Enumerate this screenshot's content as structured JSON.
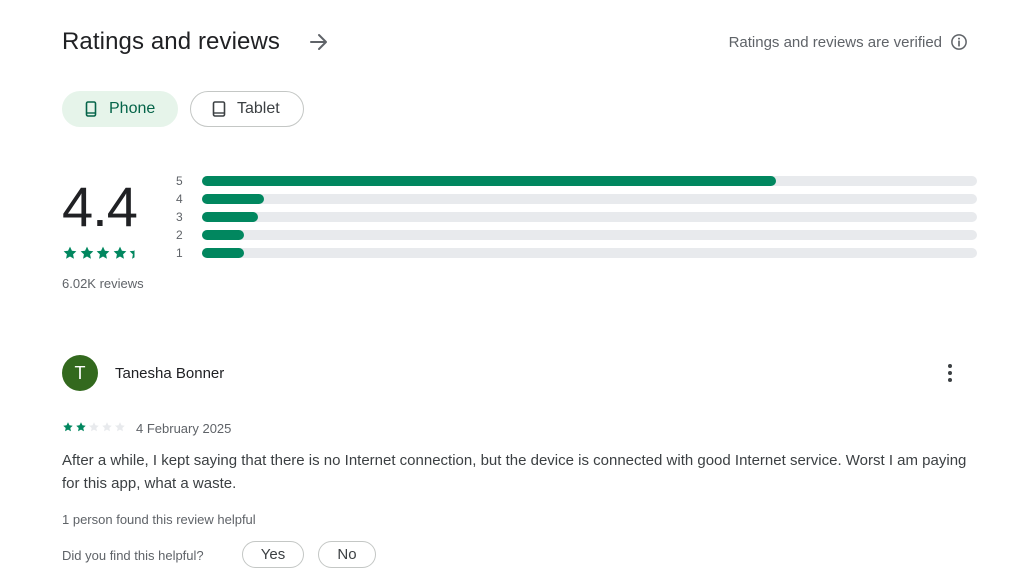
{
  "header": {
    "title": "Ratings and reviews",
    "verified_text": "Ratings and reviews are verified"
  },
  "device_tabs": [
    {
      "label": "Phone",
      "selected": true
    },
    {
      "label": "Tablet",
      "selected": false
    }
  ],
  "summary": {
    "rating": "4.4",
    "stars": 4.4,
    "review_count": "6.02K reviews"
  },
  "distribution": [
    {
      "label": "5",
      "fraction": 0.74
    },
    {
      "label": "4",
      "fraction": 0.08
    },
    {
      "label": "3",
      "fraction": 0.072
    },
    {
      "label": "2",
      "fraction": 0.054
    },
    {
      "label": "1",
      "fraction": 0.054
    }
  ],
  "review": {
    "avatar_letter": "T",
    "reviewer": "Tanesha Bonner",
    "stars": 2,
    "date": "4 February 2025",
    "text": "After a while, I kept saying that there is no Internet connection, but the device is connected with good Internet service. Worst I am paying for this app, what a waste.",
    "helpful_count": "1 person found this review helpful",
    "helpful_question": "Did you find this helpful?",
    "yes_label": "Yes",
    "no_label": "No"
  },
  "colors": {
    "accent": "#01875f",
    "chip_selected_bg": "#e6f4ea",
    "avatar_bg": "#33691e",
    "track": "#e8eaed"
  },
  "icons": [
    "arrow-right-icon",
    "info-icon",
    "phone-icon",
    "tablet-icon",
    "star-icon",
    "more-vert-icon"
  ]
}
